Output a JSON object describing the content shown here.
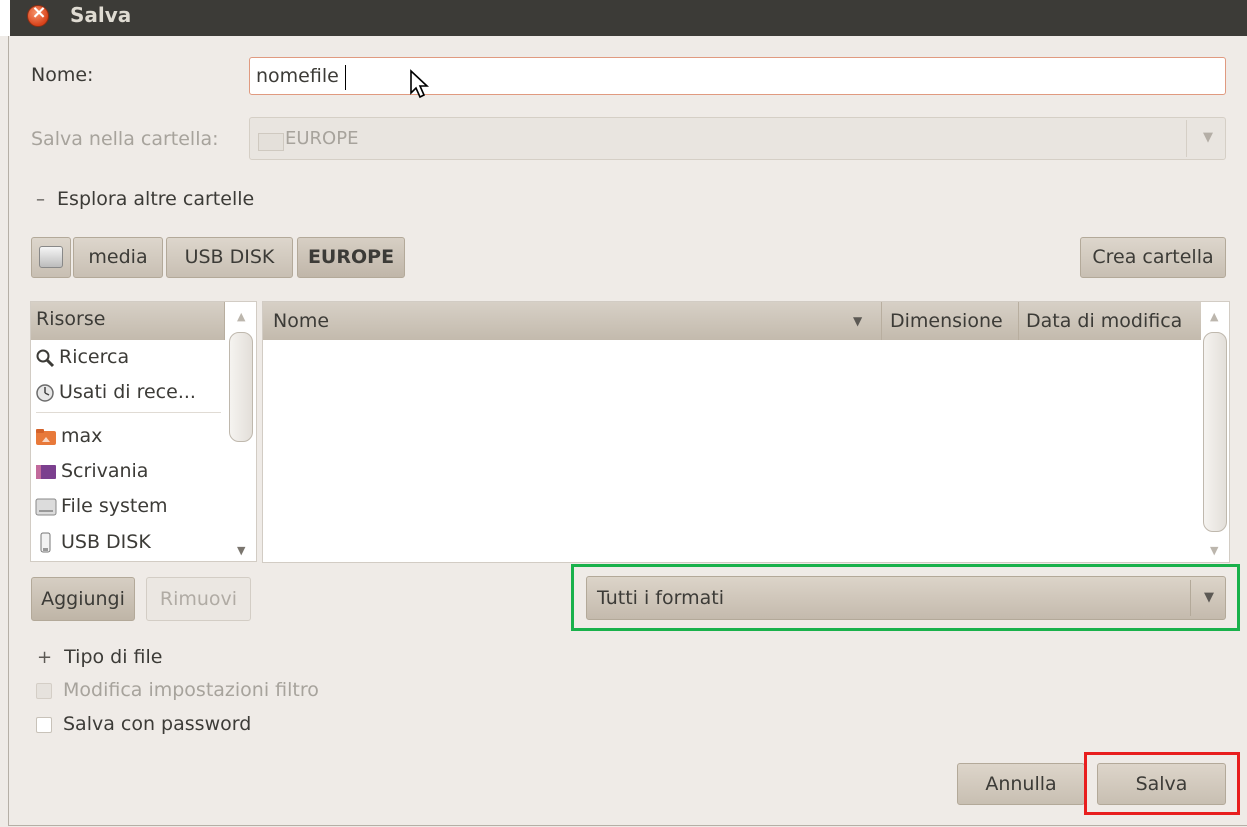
{
  "window": {
    "title": "Salva"
  },
  "form": {
    "name_label": "Nome:",
    "name_value": "nomefile",
    "folder_label": "Salva nella cartella:",
    "folder_value": "EUROPE",
    "browse_expander": "Esplora altre cartelle",
    "browse_expander_sign": "–"
  },
  "path_bar": {
    "buttons": [
      "media",
      "USB DISK",
      "EUROPE"
    ],
    "create_folder": "Crea cartella"
  },
  "places": {
    "header": "Risorse",
    "items": [
      {
        "label": "Ricerca",
        "icon": "search-icon"
      },
      {
        "label": "Usati di rece...",
        "icon": "recent-icon"
      },
      {
        "label": "max",
        "icon": "home-folder-icon"
      },
      {
        "label": "Scrivania",
        "icon": "desktop-icon"
      },
      {
        "label": "File system",
        "icon": "harddisk-icon"
      },
      {
        "label": "USB DISK",
        "icon": "usb-drive-icon"
      }
    ],
    "add_button": "Aggiungi",
    "remove_button": "Rimuovi"
  },
  "files": {
    "columns": [
      "Nome",
      "Dimensione",
      "Data di modifica"
    ]
  },
  "filter": {
    "value": "Tutti i formati"
  },
  "options": {
    "file_type_expander": "Tipo di file",
    "file_type_sign": "+",
    "edit_filter": "Modifica impostazioni filtro",
    "save_with_password": "Salva con password"
  },
  "actions": {
    "cancel": "Annulla",
    "save": "Salva"
  },
  "colors": {
    "filter_highlight": "#19b14b",
    "save_highlight": "#e81e1e"
  }
}
